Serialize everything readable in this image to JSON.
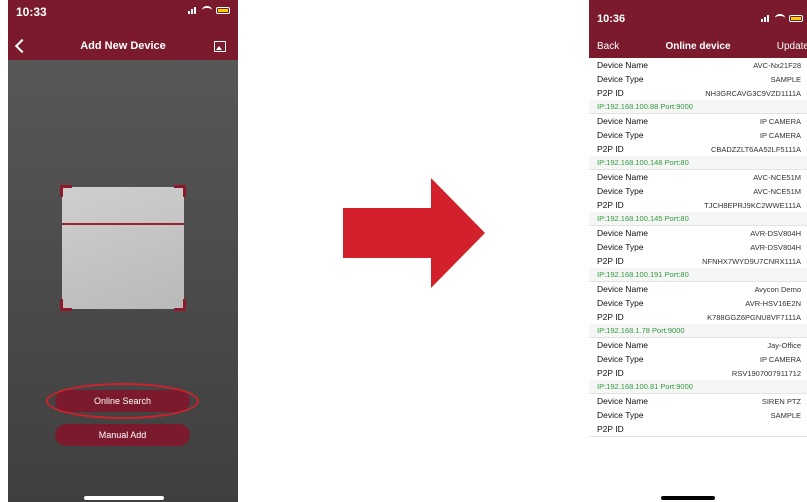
{
  "left_phone": {
    "status_time": "10:33",
    "title": "Add New Device",
    "online_search_label": "Online Search",
    "manual_add_label": "Manual Add"
  },
  "right_phone": {
    "status_time": "10:36",
    "back_label": "Back",
    "title": "Online device",
    "update_label": "Update",
    "labels": {
      "name": "Device Name",
      "type": "Device Type",
      "p2p": "P2P ID"
    },
    "devices": [
      {
        "name": "AVC-Nx21F28",
        "type": "SAMPLE",
        "p2p": "NH3GRCAVG3C9VZD1111A",
        "ip": "IP:192.168.100.88 Port:9000"
      },
      {
        "name": "IP CAMERA",
        "type": "IP CAMERA",
        "p2p": "CBADZZLT6AA52LF5111A",
        "ip": "IP:192.168.100.148 Port:80"
      },
      {
        "name": "AVC-NCE51M",
        "type": "AVC-NCE51M",
        "p2p": "TJCH8EPRJ9KC2WWE111A",
        "ip": "IP:192.168.100.145 Port:80"
      },
      {
        "name": "AVR-DSV804H",
        "type": "AVR-DSV804H",
        "p2p": "NFNHX7WYD9U7CNRX111A",
        "ip": "IP:192.168.100.191 Port:80"
      },
      {
        "name": "Avycon Demo",
        "type": "AVR-HSV16E2N",
        "p2p": "K788GGZ6PGNU8VF7111A",
        "ip": "IP:192.168.1.78 Port:9000"
      },
      {
        "name": "Jay-Office",
        "type": "IP CAMERA",
        "p2p": "RSV1907007911712",
        "ip": "IP:192.168.100.81 Port:9000"
      },
      {
        "name": "SIREN PTZ",
        "type": "SAMPLE",
        "p2p": "",
        "ip": ""
      }
    ]
  },
  "icons": {
    "back": "chevron-left-icon",
    "gallery": "image-icon",
    "arrow": "right-arrow-icon"
  },
  "colors": {
    "brand": "#7b1a2d",
    "arrow": "#d3202a",
    "ip_text": "#2e9a3c",
    "highlight_ring": "#d3202a"
  }
}
